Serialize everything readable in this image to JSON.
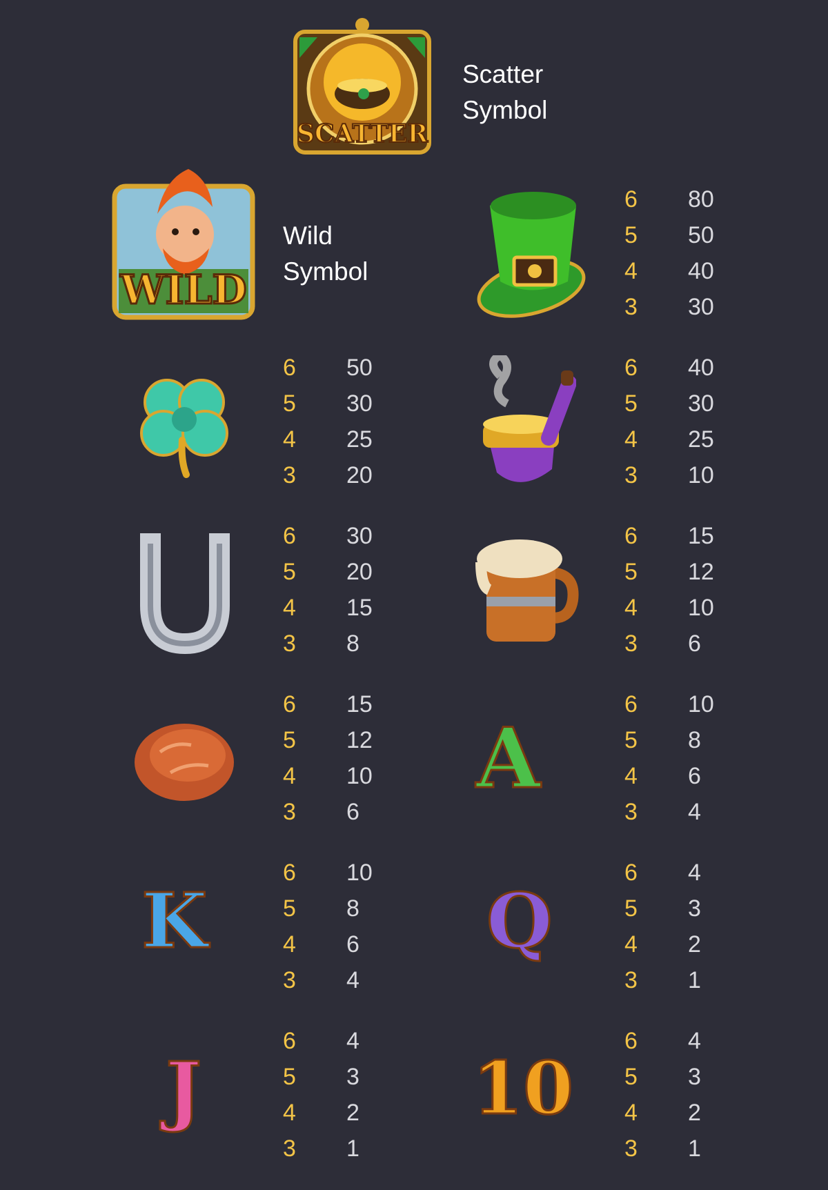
{
  "scatter": {
    "badge": "SCATTER",
    "label_line1": "Scatter",
    "label_line2": "Symbol"
  },
  "wild": {
    "badge": "WILD",
    "label_line1": "Wild",
    "label_line2": "Symbol"
  },
  "symbols": [
    {
      "name": "green-hat",
      "icon": "leprechaun-hat-icon",
      "rows": [
        {
          "count": "6",
          "pay": "80"
        },
        {
          "count": "5",
          "pay": "50"
        },
        {
          "count": "4",
          "pay": "40"
        },
        {
          "count": "3",
          "pay": "30"
        }
      ]
    },
    {
      "name": "clover",
      "icon": "four-leaf-clover-icon",
      "rows": [
        {
          "count": "6",
          "pay": "50"
        },
        {
          "count": "5",
          "pay": "30"
        },
        {
          "count": "4",
          "pay": "25"
        },
        {
          "count": "3",
          "pay": "20"
        }
      ]
    },
    {
      "name": "pipe",
      "icon": "smoking-pipe-icon",
      "rows": [
        {
          "count": "6",
          "pay": "40"
        },
        {
          "count": "5",
          "pay": "30"
        },
        {
          "count": "4",
          "pay": "25"
        },
        {
          "count": "3",
          "pay": "10"
        }
      ]
    },
    {
      "name": "horseshoe",
      "icon": "horseshoe-icon",
      "rows": [
        {
          "count": "6",
          "pay": "30"
        },
        {
          "count": "5",
          "pay": "20"
        },
        {
          "count": "4",
          "pay": "15"
        },
        {
          "count": "3",
          "pay": "8"
        }
      ]
    },
    {
      "name": "beer-mug",
      "icon": "beer-mug-icon",
      "rows": [
        {
          "count": "6",
          "pay": "15"
        },
        {
          "count": "5",
          "pay": "12"
        },
        {
          "count": "4",
          "pay": "10"
        },
        {
          "count": "3",
          "pay": "6"
        }
      ]
    },
    {
      "name": "bread",
      "icon": "bread-loaf-icon",
      "rows": [
        {
          "count": "6",
          "pay": "15"
        },
        {
          "count": "5",
          "pay": "12"
        },
        {
          "count": "4",
          "pay": "10"
        },
        {
          "count": "3",
          "pay": "6"
        }
      ]
    },
    {
      "name": "ace",
      "icon": "letter-a-icon",
      "glyph": "A",
      "rows": [
        {
          "count": "6",
          "pay": "10"
        },
        {
          "count": "5",
          "pay": "8"
        },
        {
          "count": "4",
          "pay": "6"
        },
        {
          "count": "3",
          "pay": "4"
        }
      ]
    },
    {
      "name": "king",
      "icon": "letter-k-icon",
      "glyph": "K",
      "rows": [
        {
          "count": "6",
          "pay": "10"
        },
        {
          "count": "5",
          "pay": "8"
        },
        {
          "count": "4",
          "pay": "6"
        },
        {
          "count": "3",
          "pay": "4"
        }
      ]
    },
    {
      "name": "queen",
      "icon": "letter-q-icon",
      "glyph": "Q",
      "rows": [
        {
          "count": "6",
          "pay": "4"
        },
        {
          "count": "5",
          "pay": "3"
        },
        {
          "count": "4",
          "pay": "2"
        },
        {
          "count": "3",
          "pay": "1"
        }
      ]
    },
    {
      "name": "jack",
      "icon": "letter-j-icon",
      "glyph": "J",
      "rows": [
        {
          "count": "6",
          "pay": "4"
        },
        {
          "count": "5",
          "pay": "3"
        },
        {
          "count": "4",
          "pay": "2"
        },
        {
          "count": "3",
          "pay": "1"
        }
      ]
    },
    {
      "name": "ten",
      "icon": "number-ten-icon",
      "glyph": "10",
      "rows": [
        {
          "count": "6",
          "pay": "4"
        },
        {
          "count": "5",
          "pay": "3"
        },
        {
          "count": "4",
          "pay": "2"
        },
        {
          "count": "3",
          "pay": "1"
        }
      ]
    }
  ],
  "colors": {
    "background": "#2d2d38",
    "count": "#f3c447",
    "pay": "#d9d9de",
    "label": "#ffffff"
  }
}
